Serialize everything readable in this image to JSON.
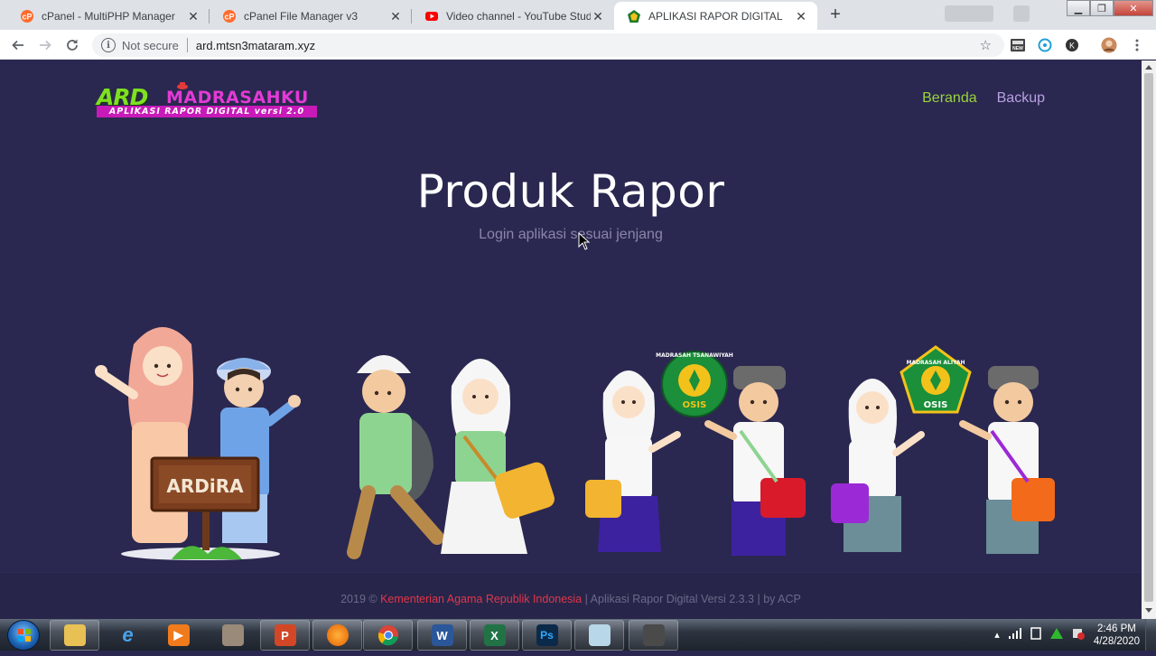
{
  "browser": {
    "tabs": [
      {
        "title": "cPanel - MultiPHP Manager",
        "icon": "cpanel-icon"
      },
      {
        "title": "cPanel File Manager v3",
        "icon": "cpanel-icon"
      },
      {
        "title": "Video channel - YouTube Studio",
        "icon": "youtube-icon"
      },
      {
        "title": "APLIKASI RAPOR DIGITAL",
        "icon": "madrasah-emblem-icon"
      }
    ],
    "active_tab_index": 3,
    "address": {
      "security_label": "Not secure",
      "url": "ard.mtsn3mataram.xyz"
    }
  },
  "page": {
    "logo": {
      "ard": "ARD",
      "madrasah": "MADRASAHKU",
      "tagline": "APLIKASI RAPOR DIGITAL versi 2.0"
    },
    "nav": {
      "home": "Beranda",
      "backup": "Backup"
    },
    "hero": {
      "title": "Produk Rapor",
      "subtitle": "Login aplikasi sesuai jenjang"
    },
    "signboard": "ARDiRA",
    "badges": [
      {
        "top": "MADRASAH TSANAWIYAH",
        "bottom": "OSIS"
      },
      {
        "top": "MADRASAH ALIYAH",
        "bottom": "OSIS"
      }
    ],
    "footer": {
      "year": "2019 ©",
      "org": "Kementerian Agama Republik Indonesia",
      "rest": "| Aplikasi Rapor Digital Versi 2.3.3 | by ACP"
    }
  },
  "taskbar": {
    "apps": [
      "explorer-icon",
      "internet-explorer-icon",
      "media-player-icon",
      "tools-icon",
      "powerpoint-icon",
      "firefox-icon",
      "chrome-icon",
      "word-icon",
      "excel-icon",
      "photoshop-icon",
      "notes-icon",
      "camera-tool-icon"
    ],
    "time": "2:46 PM",
    "date": "4/28/2020"
  },
  "colors": {
    "page_bg": "#2a2850",
    "nav_home": "#9bd43c",
    "nav_backup": "#b9a0e3",
    "footer_link": "#e0374b",
    "logo_green": "#7ee021",
    "logo_magenta": "#c71ab8"
  }
}
